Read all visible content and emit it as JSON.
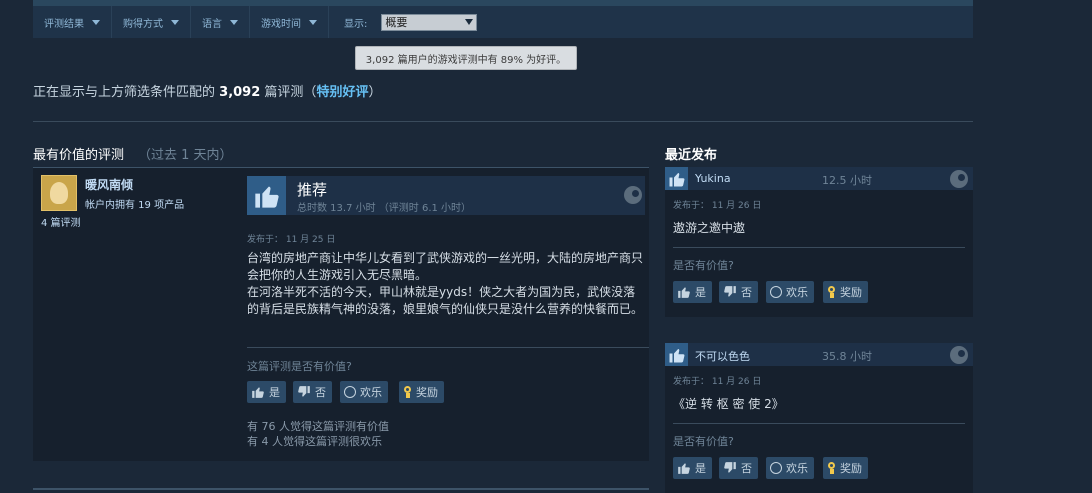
{
  "filters": {
    "items": [
      "评测结果",
      "购得方式",
      "语言",
      "游戏时间"
    ],
    "display_label": "显示:",
    "display_value": "概要"
  },
  "tooltip": "3,092 篇用户的游戏评测中有 89% 为好评。",
  "summary": {
    "prefix": "正在显示与上方筛选条件匹配的",
    "count": "3,092",
    "suffix": "篇评测（",
    "rating": "特别好评",
    "close": "）"
  },
  "most_helpful": {
    "title": "最有价值的评测",
    "subtitle": "（过去 1 天内）"
  },
  "review": {
    "user_name": "暖风南倾",
    "products": "帐户内拥有 19 项产品",
    "review_count": "4 篇评测",
    "verdict": "推荐",
    "hours": "总时数 13.7 小时 （评测时 6.1 小时）",
    "posted": "发布于： 11 月 25 日",
    "text_line1": "台湾的房地产商让中华儿女看到了武侠游戏的一丝光明，大陆的房地产商只会把你的人生游戏引入无尽黑暗。",
    "text_line2": "在河洛半死不活的今天，甲山林就是yyds！侠之大者为国为民，武侠没落的背后是民族精气神的没落，娘里娘气的仙侠只是没什么营养的快餐而已。",
    "helpful_question": "这篇评测是否有价值?",
    "btn_yes": "是",
    "btn_no": "否",
    "btn_funny": "欢乐",
    "btn_award": "奖励",
    "votes_helpful": "有 76 人觉得这篇评测有价值",
    "votes_funny": "有 4 人觉得这篇评测很欢乐"
  },
  "recent": {
    "title": "最近发布",
    "items": [
      {
        "name": "Yukina",
        "time": "12.5 小时",
        "posted": "发布于： 11 月 26 日",
        "text": "遨游之邀中遨",
        "helpful_question": "是否有价值?",
        "btn_yes": "是",
        "btn_no": "否",
        "btn_funny": "欢乐",
        "btn_award": "奖励"
      },
      {
        "name": "不可以色色",
        "time": "35.8 小时",
        "posted": "发布于： 11 月 26 日",
        "text": "《逆 转 枢 密 使 2》",
        "helpful_question": "是否有价值?",
        "btn_yes": "是",
        "btn_no": "否",
        "btn_funny": "欢乐",
        "btn_award": "奖励"
      }
    ]
  }
}
